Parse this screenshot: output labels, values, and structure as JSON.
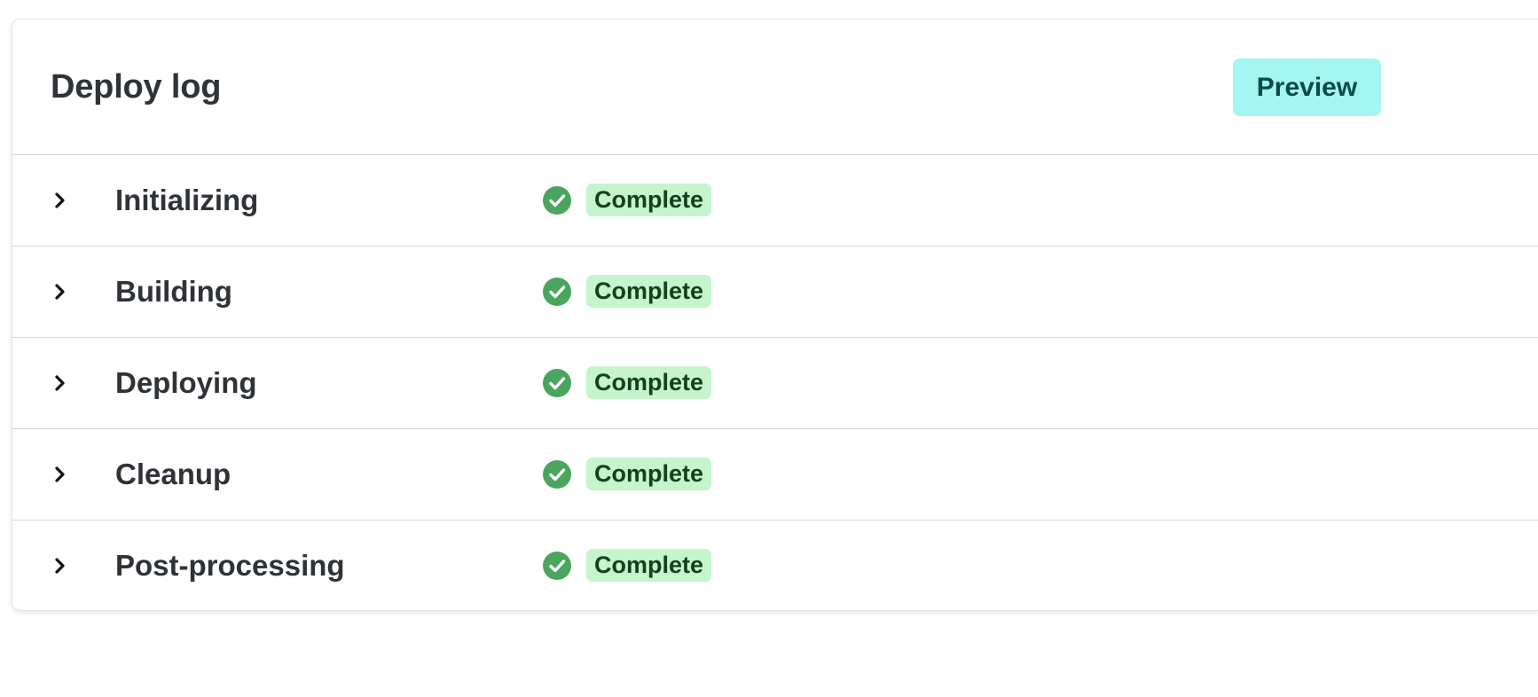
{
  "header": {
    "title": "Deploy log",
    "preview_label": "Preview"
  },
  "steps": [
    {
      "label": "Initializing",
      "status": "Complete"
    },
    {
      "label": "Building",
      "status": "Complete"
    },
    {
      "label": "Deploying",
      "status": "Complete"
    },
    {
      "label": "Cleanup",
      "status": "Complete"
    },
    {
      "label": "Post-processing",
      "status": "Complete"
    }
  ],
  "icons": {
    "expand": "chevron-right-icon",
    "status": "check-circle-icon"
  },
  "colors": {
    "accent_button_bg": "#a4f6f0",
    "accent_button_text": "#0b4a48",
    "success_icon": "#4aa55e",
    "success_badge_bg": "#c4f5cd",
    "success_badge_text": "#14401d"
  }
}
